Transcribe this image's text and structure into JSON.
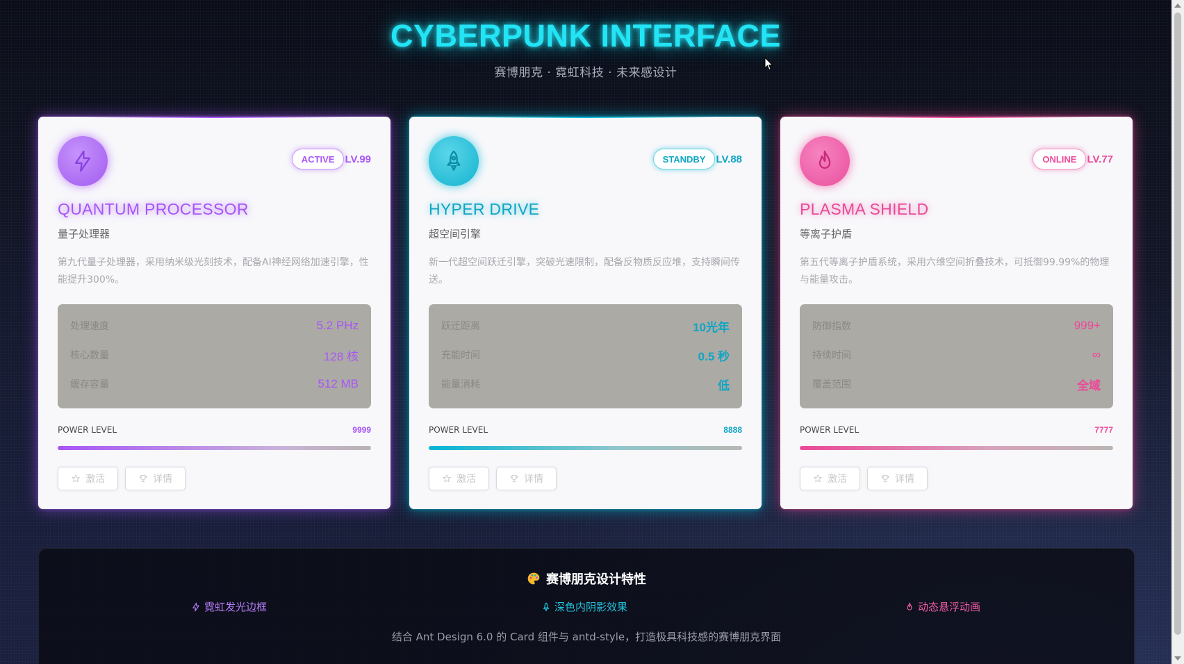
{
  "header": {
    "title": "CYBERPUNK INTERFACE",
    "subtitle": "赛博朋克 · 霓虹科技 · 未来感设计"
  },
  "colors": {
    "purple": "#a855f7",
    "cyan": "#06b6d4",
    "pink": "#ec4899",
    "title_glow": "#22e4f5"
  },
  "cards": [
    {
      "icon": "thunderbolt-icon",
      "status": "ACTIVE",
      "level": "LV.99",
      "title": "QUANTUM PROCESSOR",
      "subtitle": "量子处理器",
      "description": "第九代量子处理器，采用纳米级光刻技术，配备AI神经网络加速引擎，性能提升300%。",
      "stats": [
        {
          "label": "处理速度",
          "value": "5.2 PHz"
        },
        {
          "label": "核心数量",
          "value": "128 核"
        },
        {
          "label": "缓存容量",
          "value": "512 MB"
        }
      ],
      "power_label": "POWER LEVEL",
      "power_value": "9999",
      "power_fraction": 1.0,
      "buttons": [
        {
          "label": "激活",
          "icon": "star-icon"
        },
        {
          "label": "详情",
          "icon": "trophy-icon"
        }
      ]
    },
    {
      "icon": "rocket-icon",
      "status": "STANDBY",
      "level": "LV.88",
      "title": "HYPER DRIVE",
      "subtitle": "超空间引擎",
      "description": "新一代超空间跃迁引擎，突破光速限制，配备反物质反应堆，支持瞬间传送。",
      "stats": [
        {
          "label": "跃迁距离",
          "value": "10光年"
        },
        {
          "label": "充能时间",
          "value": "0.5 秒"
        },
        {
          "label": "能量消耗",
          "value": "低"
        }
      ],
      "power_label": "POWER LEVEL",
      "power_value": "8888",
      "power_fraction": 1.0,
      "buttons": [
        {
          "label": "激活",
          "icon": "star-icon"
        },
        {
          "label": "详情",
          "icon": "trophy-icon"
        }
      ]
    },
    {
      "icon": "fire-icon",
      "status": "ONLINE",
      "level": "LV.77",
      "title": "PLASMA SHIELD",
      "subtitle": "等离子护盾",
      "description": "第五代等离子护盾系统，采用六维空间折叠技术，可抵御99.99%的物理与能量攻击。",
      "stats": [
        {
          "label": "防御指数",
          "value": "999+"
        },
        {
          "label": "持续时间",
          "value": "∞"
        },
        {
          "label": "覆盖范围",
          "value": "全域"
        }
      ],
      "power_label": "POWER LEVEL",
      "power_value": "7777",
      "power_fraction": 1.0,
      "buttons": [
        {
          "label": "激活",
          "icon": "star-icon"
        },
        {
          "label": "详情",
          "icon": "trophy-icon"
        }
      ]
    }
  ],
  "features": {
    "title_icon": "palette-icon",
    "title": "赛博朋克设计特性",
    "items": [
      {
        "icon": "thunderbolt-icon",
        "label": "霓虹发光边框"
      },
      {
        "icon": "rocket-icon",
        "label": "深色内阴影效果"
      },
      {
        "icon": "fire-icon",
        "label": "动态悬浮动画"
      }
    ],
    "footer": "结合 Ant Design 6.0 的 Card 组件与 antd-style，打造极具科技感的赛博朋克界面"
  }
}
